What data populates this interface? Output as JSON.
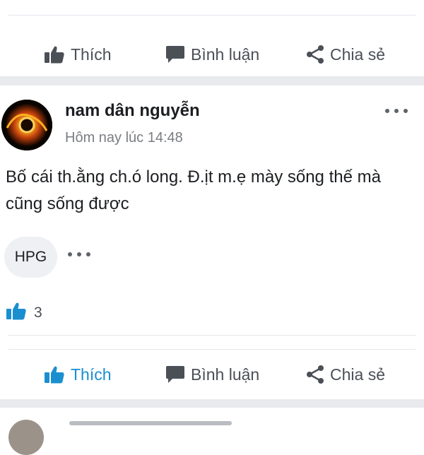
{
  "actions": {
    "like_label": "Thích",
    "comment_label": "Bình luận",
    "share_label": "Chia sẻ"
  },
  "post": {
    "author": "nam dân nguyễn",
    "timestamp": "Hôm nay lúc 14:48",
    "text": "Bố cái th.ằng ch.ó long. Đ.ịt m.ẹ mày sống thế mà cũng sống được",
    "tag": "HPG",
    "like_count": "3"
  },
  "colors": {
    "liked_accent": "#1a8fd0",
    "action_gray": "#4b4f56",
    "divider": "#e9eaee"
  },
  "icons": [
    "thumbs-up-icon",
    "comment-icon",
    "share-icon",
    "more-dots-icon"
  ]
}
